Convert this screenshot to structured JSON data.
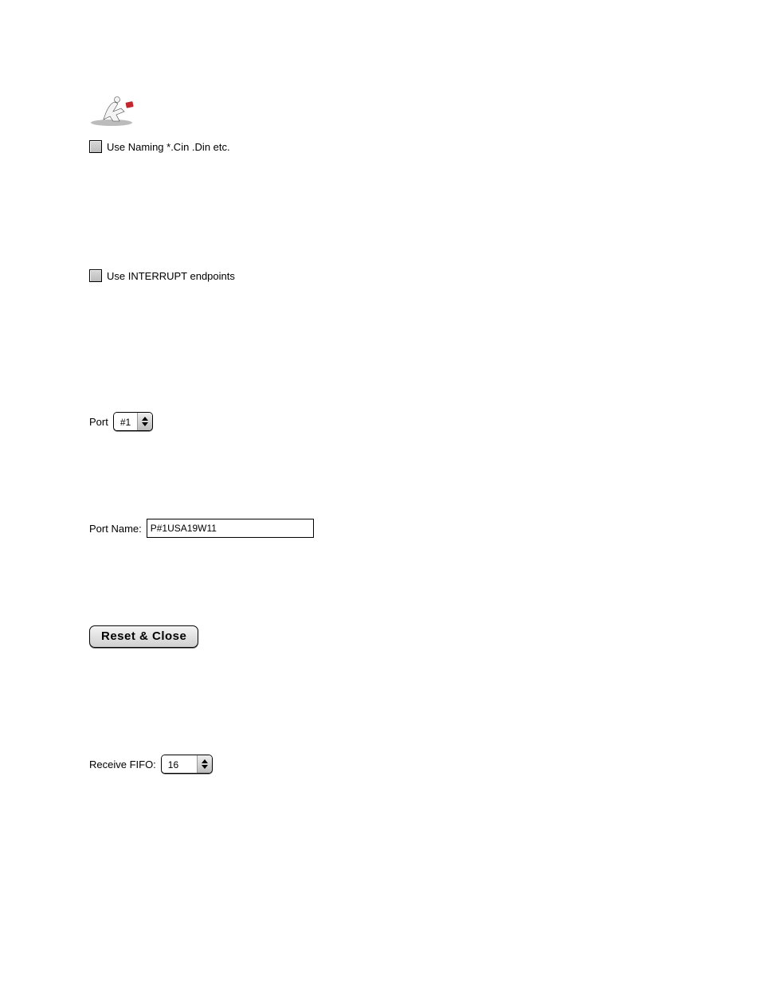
{
  "checkboxes": {
    "naming_label": "Use Naming *.Cin .Din etc.",
    "interrupt_label": "Use INTERRUPT endpoints"
  },
  "port_selector": {
    "label": "Port",
    "value": "#1"
  },
  "port_name": {
    "label": "Port Name:",
    "value": "P#1USA19W11"
  },
  "reset_button_label": "Reset & Close",
  "receive_fifo": {
    "label": "Receive FIFO:",
    "value": "16"
  }
}
